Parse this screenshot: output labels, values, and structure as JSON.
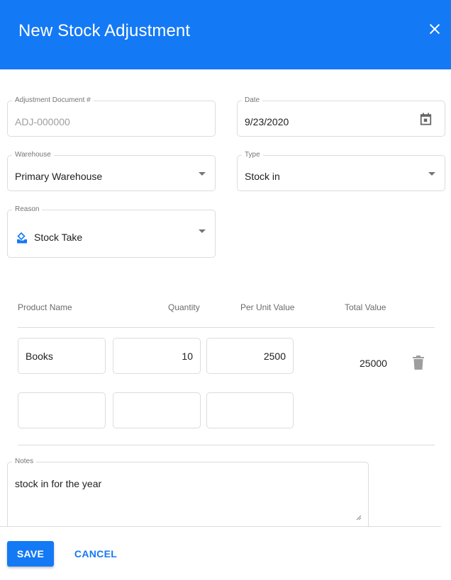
{
  "dialog": {
    "title": "New Stock Adjustment",
    "close_icon": "close-icon",
    "header_color": "#1479f5"
  },
  "form": {
    "adjustment_document": {
      "label": "Adjustment Document #",
      "value": "ADJ-000000"
    },
    "date": {
      "label": "Date",
      "value": "9/23/2020",
      "icon": "calendar-icon"
    },
    "warehouse": {
      "label": "Warehouse",
      "value": "Primary Warehouse"
    },
    "type": {
      "label": "Type",
      "value": "Stock in"
    },
    "reason": {
      "label": "Reason",
      "value": "Stock Take",
      "icon": "stock-take-icon"
    }
  },
  "items_table": {
    "columns": [
      "Product Name",
      "Quantity",
      "Per Unit Value",
      "Total Value"
    ],
    "rows": [
      {
        "product_name": "Books",
        "quantity": "10",
        "per_unit_value": "2500",
        "total_value": "25000",
        "delete_icon": "trash-icon"
      },
      {
        "product_name": "",
        "quantity": "",
        "per_unit_value": "",
        "total_value": ""
      }
    ]
  },
  "notes": {
    "label": "Notes",
    "value": "stock in for the year"
  },
  "footer": {
    "save_label": "SAVE",
    "cancel_label": "CANCEL"
  }
}
